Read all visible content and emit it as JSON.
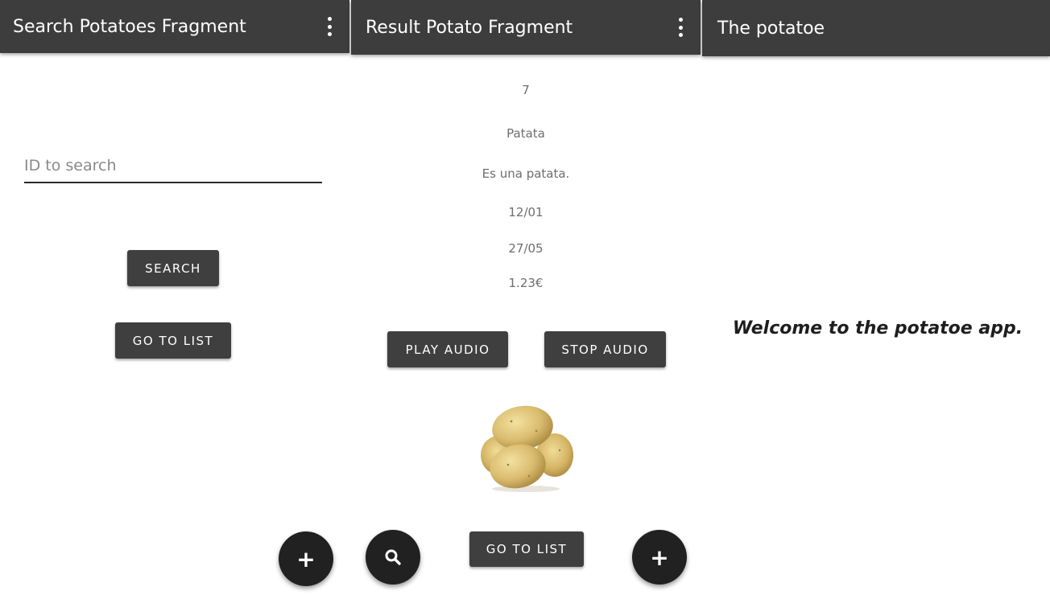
{
  "search_screen": {
    "title": "Search Potatoes Fragment",
    "id_placeholder": "ID to search",
    "search_label": "SEARCH",
    "go_to_list_label": "GO TO LIST",
    "fab_add_icon": "plus-icon"
  },
  "result_screen": {
    "title": "Result Potato Fragment",
    "id": "7",
    "name": "Patata",
    "description": "Es una patata.",
    "date_1": "12/01",
    "date_2": "27/05",
    "price": "1.23€",
    "play_audio_label": "PLAY AUDIO",
    "stop_audio_label": "STOP AUDIO",
    "go_to_list_label": "GO TO LIST",
    "fab_search_icon": "search-icon",
    "fab_add_icon": "plus-icon"
  },
  "welcome_screen": {
    "title": "The potatoe",
    "welcome_text": "Welcome to the potatoe app."
  },
  "colors": {
    "app_bar": "#3d3d3d",
    "button": "#3f3f3f",
    "fab": "#212121",
    "detail_text": "#6e6e6e"
  }
}
